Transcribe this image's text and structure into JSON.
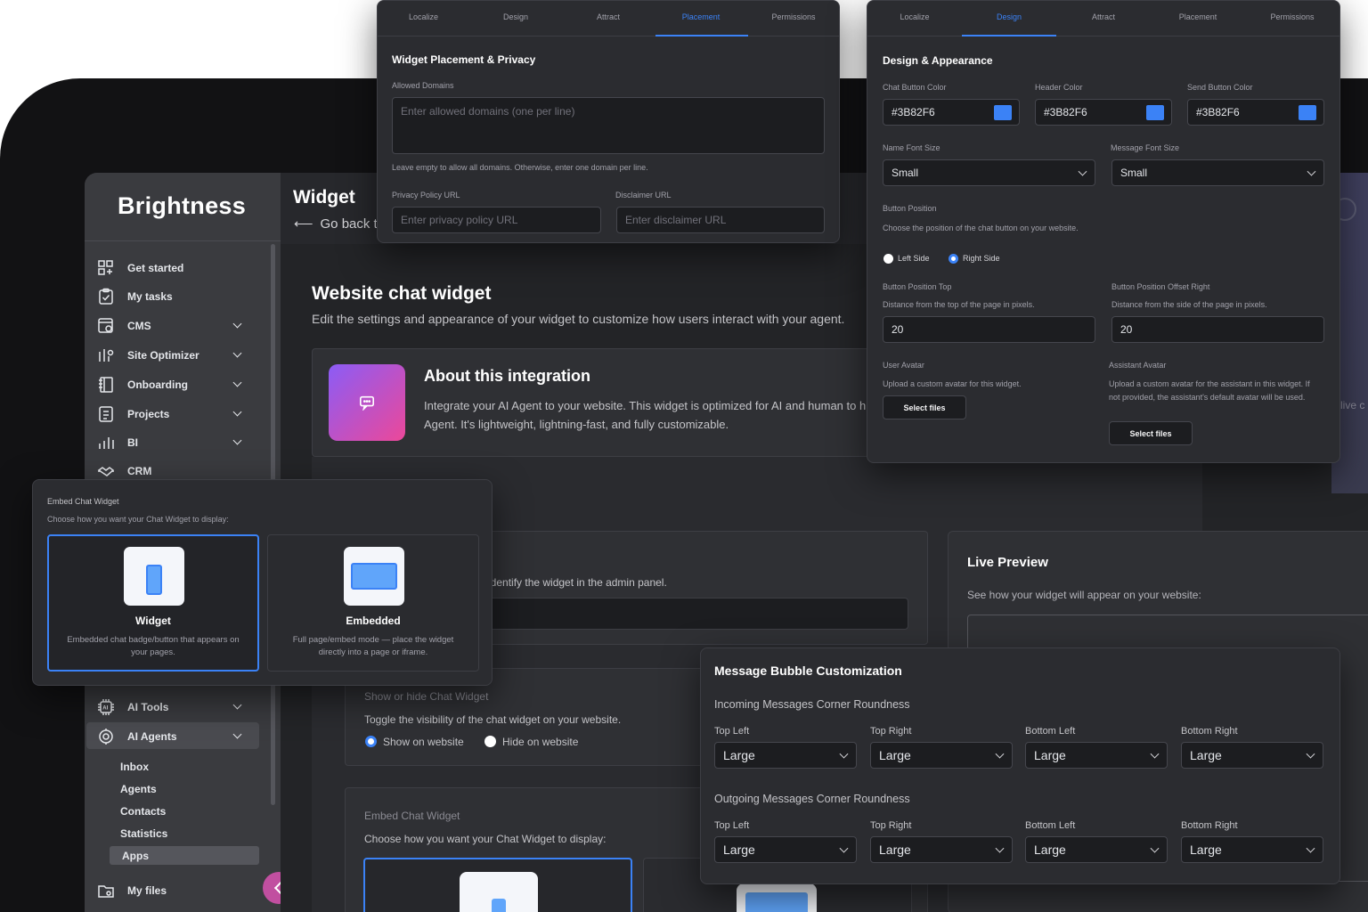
{
  "colors": {
    "accent": "#3B82F6",
    "app_bg": "#121214",
    "panel_bg": "#2b2c30",
    "sidebar_bg": "#3a3b3f",
    "integration_gradient_start": "#8b5cf6",
    "integration_gradient_end": "#ec4899",
    "back_arrow_bg": "#c14fa0"
  },
  "brand": {
    "name": "Brightness"
  },
  "sidebar": {
    "items": [
      {
        "label": "Get started",
        "icon": "grid-icon",
        "has_chevron": false
      },
      {
        "label": "My tasks",
        "icon": "clipboard-check-icon",
        "has_chevron": false
      },
      {
        "label": "CMS",
        "icon": "cms-icon",
        "has_chevron": true
      },
      {
        "label": "Site Optimizer",
        "icon": "optimizer-icon",
        "has_chevron": true
      },
      {
        "label": "Onboarding",
        "icon": "notebook-icon",
        "has_chevron": true
      },
      {
        "label": "Projects",
        "icon": "document-icon",
        "has_chevron": true
      },
      {
        "label": "BI",
        "icon": "bar-chart-icon",
        "has_chevron": true
      },
      {
        "label": "CRM",
        "icon": "handshake-icon",
        "has_chevron": false
      }
    ],
    "lower_items": [
      {
        "label": "AI Tools",
        "icon": "ai-chip-icon",
        "has_chevron": true
      },
      {
        "label": "AI Agents",
        "icon": "robot-icon",
        "has_chevron": true,
        "active": true
      }
    ],
    "sub_items": [
      "Inbox",
      "Agents",
      "Contacts",
      "Statistics",
      "Apps"
    ],
    "sub_active": "Apps",
    "bottom_item": {
      "label": "My files",
      "icon": "folder-icon"
    }
  },
  "page": {
    "title": "Widget",
    "back_label": "Go back to",
    "heading": "Website chat widget",
    "subheading": "Edit the settings and appearance of your widget to customize how users interact with your agent.",
    "about_title": "About this integration",
    "about_text_1": "Integrate your AI Agent to your website. This widget is optimized for AI and human to hum",
    "about_text_2": "Agent. It's lightweight, lightning-fast, and fully customizable.",
    "name_hint": "identify the widget in the admin panel.",
    "visibility_label": "Show or hide Chat Widget",
    "visibility_desc": "Toggle the visibility of the chat widget on your website.",
    "visibility_options": [
      "Show on website",
      "Hide on website"
    ],
    "embed_label": "Embed Chat Widget",
    "embed_desc": "Choose how you want your Chat Widget to display:",
    "live_preview_title": "Live Preview",
    "live_preview_desc": "See how your widget will appear on your website:",
    "right_edge_text": "live c"
  },
  "placement_panel": {
    "tabs": [
      "Localize",
      "Design",
      "Attract",
      "Placement",
      "Permissions"
    ],
    "active_tab": "Placement",
    "title": "Widget Placement & Privacy",
    "allowed_domains_label": "Allowed Domains",
    "allowed_domains_placeholder": "Enter allowed domains (one per line)",
    "allowed_domains_hint": "Leave empty to allow all domains. Otherwise, enter one domain per line.",
    "privacy_label": "Privacy Policy URL",
    "privacy_placeholder": "Enter privacy policy URL",
    "disclaimer_label": "Disclaimer URL",
    "disclaimer_placeholder": "Enter disclaimer URL"
  },
  "design_panel": {
    "tabs": [
      "Localize",
      "Design",
      "Attract",
      "Placement",
      "Permissions"
    ],
    "active_tab": "Design",
    "title": "Design & Appearance",
    "chat_button_color_label": "Chat Button Color",
    "chat_button_color": "#3B82F6",
    "header_color_label": "Header Color",
    "header_color": "#3B82F6",
    "send_button_color_label": "Send Button Color",
    "send_button_color": "#3B82F6",
    "name_font_size_label": "Name Font Size",
    "name_font_size": "Small",
    "message_font_size_label": "Message Font Size",
    "message_font_size": "Small",
    "button_position_label": "Button Position",
    "button_position_desc": "Choose the position of the chat button on your website.",
    "position_options": [
      "Left Side",
      "Right Side"
    ],
    "position_selected": "Right Side",
    "position_top_label": "Button Position Top",
    "position_top_desc": "Distance from the top of the page in pixels.",
    "position_top_value": "20",
    "offset_right_label": "Button Position Offset Right",
    "offset_right_desc": "Distance from the side of the page in pixels.",
    "offset_right_value": "20",
    "user_avatar_label": "User Avatar",
    "user_avatar_desc": "Upload a custom avatar for this widget.",
    "assistant_avatar_label": "Assistant Avatar",
    "assistant_avatar_desc": "Upload a custom avatar for the assistant in this widget. If not provided, the assistant's default avatar will be used.",
    "select_files_label": "Select files"
  },
  "embed_panel": {
    "label": "Embed Chat Widget",
    "desc": "Choose how you want your Chat Widget to display:",
    "options": [
      {
        "title": "Widget",
        "desc": "Embedded chat badge/button that appears on your pages.",
        "selected": true
      },
      {
        "title": "Embedded",
        "desc": "Full page/embed mode — place the widget directly into a page or iframe.",
        "selected": false
      }
    ]
  },
  "bubble_panel": {
    "title": "Message Bubble Customization",
    "incoming_label": "Incoming Messages Corner Roundness",
    "outgoing_label": "Outgoing Messages Corner Roundness",
    "corners": [
      "Top Left",
      "Top Right",
      "Bottom Left",
      "Bottom Right"
    ],
    "incoming_values": [
      "Large",
      "Large",
      "Large",
      "Large"
    ],
    "outgoing_values": [
      "Large",
      "Large",
      "Large",
      "Large"
    ]
  }
}
